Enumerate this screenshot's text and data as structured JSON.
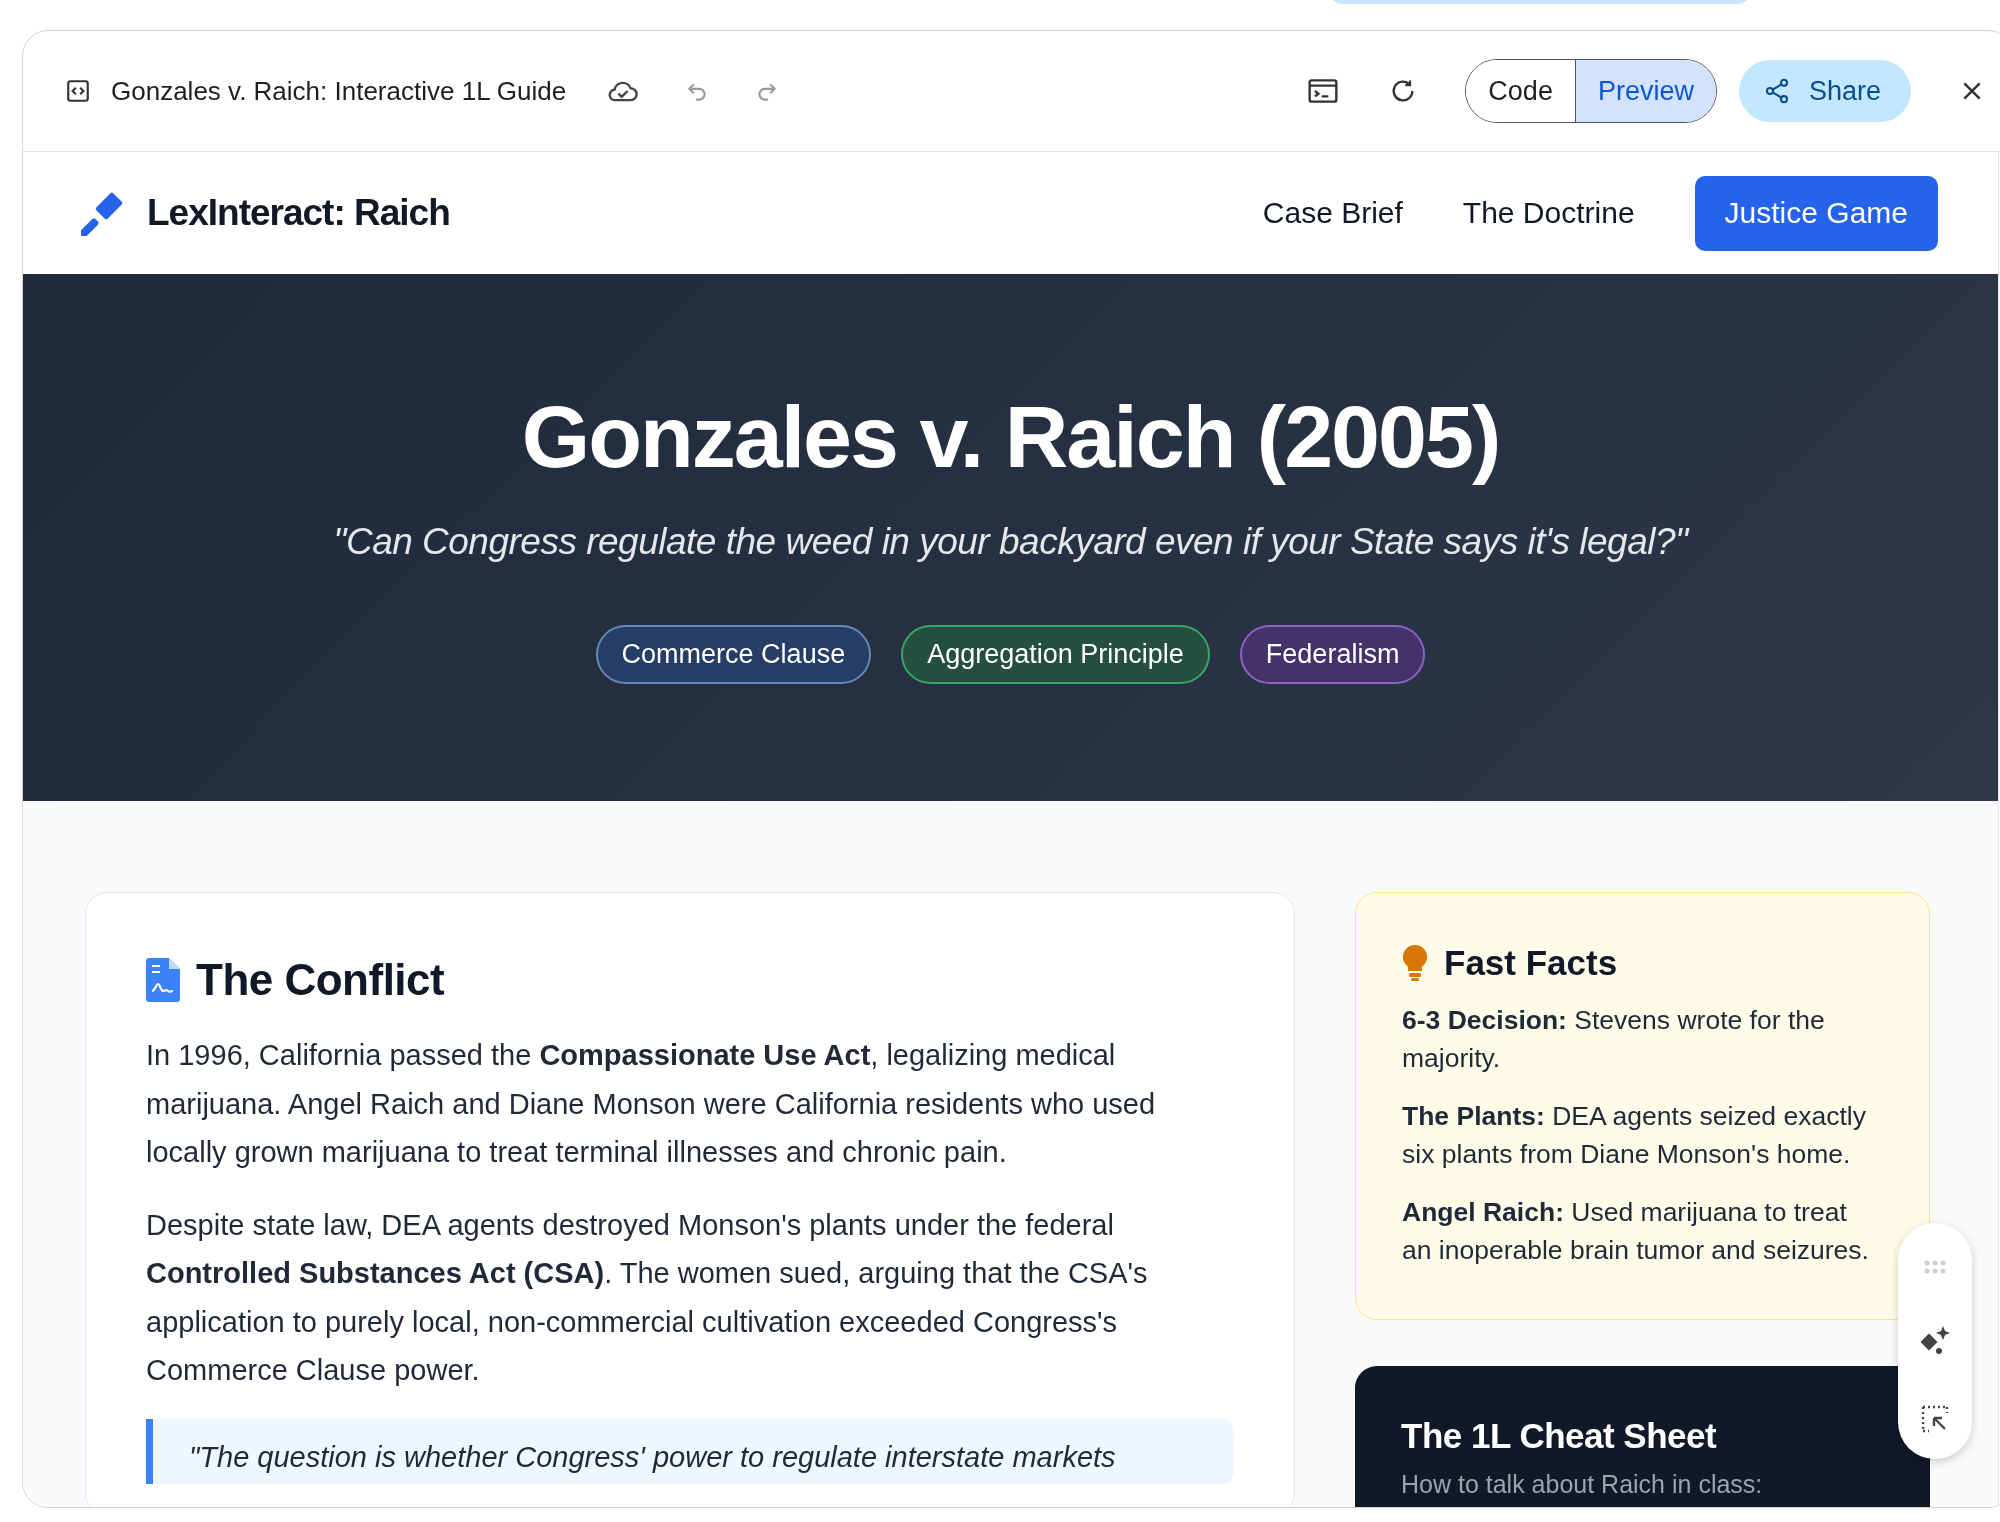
{
  "editor_bar": {
    "title": "Gonzales v. Raich: Interactive 1L Guide",
    "view_modes": [
      {
        "label": "Code",
        "selected": false
      },
      {
        "label": "Preview",
        "selected": true
      }
    ],
    "share_label": "Share"
  },
  "nav": {
    "logo": "LexInteract: Raich",
    "links": [
      {
        "label": "Case Brief",
        "kind": "link"
      },
      {
        "label": "The Doctrine",
        "kind": "link"
      },
      {
        "label": "Justice Game",
        "kind": "button"
      }
    ]
  },
  "hero": {
    "title": "Gonzales v. Raich (2005)",
    "subtitle": "\"Can Congress regulate the weed in your backyard even if your State says it's legal?\"",
    "tags": [
      {
        "label": "Commerce Clause",
        "color": "#263d66"
      },
      {
        "label": "Aggregation Principle",
        "color": "#25503f"
      },
      {
        "label": "Federalism",
        "color": "#44326b"
      }
    ]
  },
  "conflict": {
    "heading": "The Conflict",
    "paragraphs": [
      "In 1996, California passed the **Compassionate Use Act**, legalizing medical marijuana. Angel Raich and Diane Monson were California residents who used locally grown marijuana to treat terminal illnesses and chronic pain.",
      "Despite state law, DEA agents destroyed Monson's plants under the federal **Controlled Substances Act (CSA)**. The women sued, arguing that the CSA's application to purely local, non-commercial cultivation exceeded Congress's Commerce Clause power."
    ],
    "quote": "\"The question is whether Congress' power to regulate interstate markets"
  },
  "fast_facts": {
    "heading": "Fast Facts",
    "items": [
      "**6-3 Decision:** Stevens wrote for the majority.",
      "**The Plants:** DEA agents seized exactly six plants from Diane Monson's home.",
      "**Angel Raich:** Used marijuana to treat an inoperable brain tumor and seizures."
    ]
  },
  "cheat_sheet": {
    "heading": "The 1L Cheat Sheet",
    "subtitle": "How to talk about Raich in class:"
  }
}
